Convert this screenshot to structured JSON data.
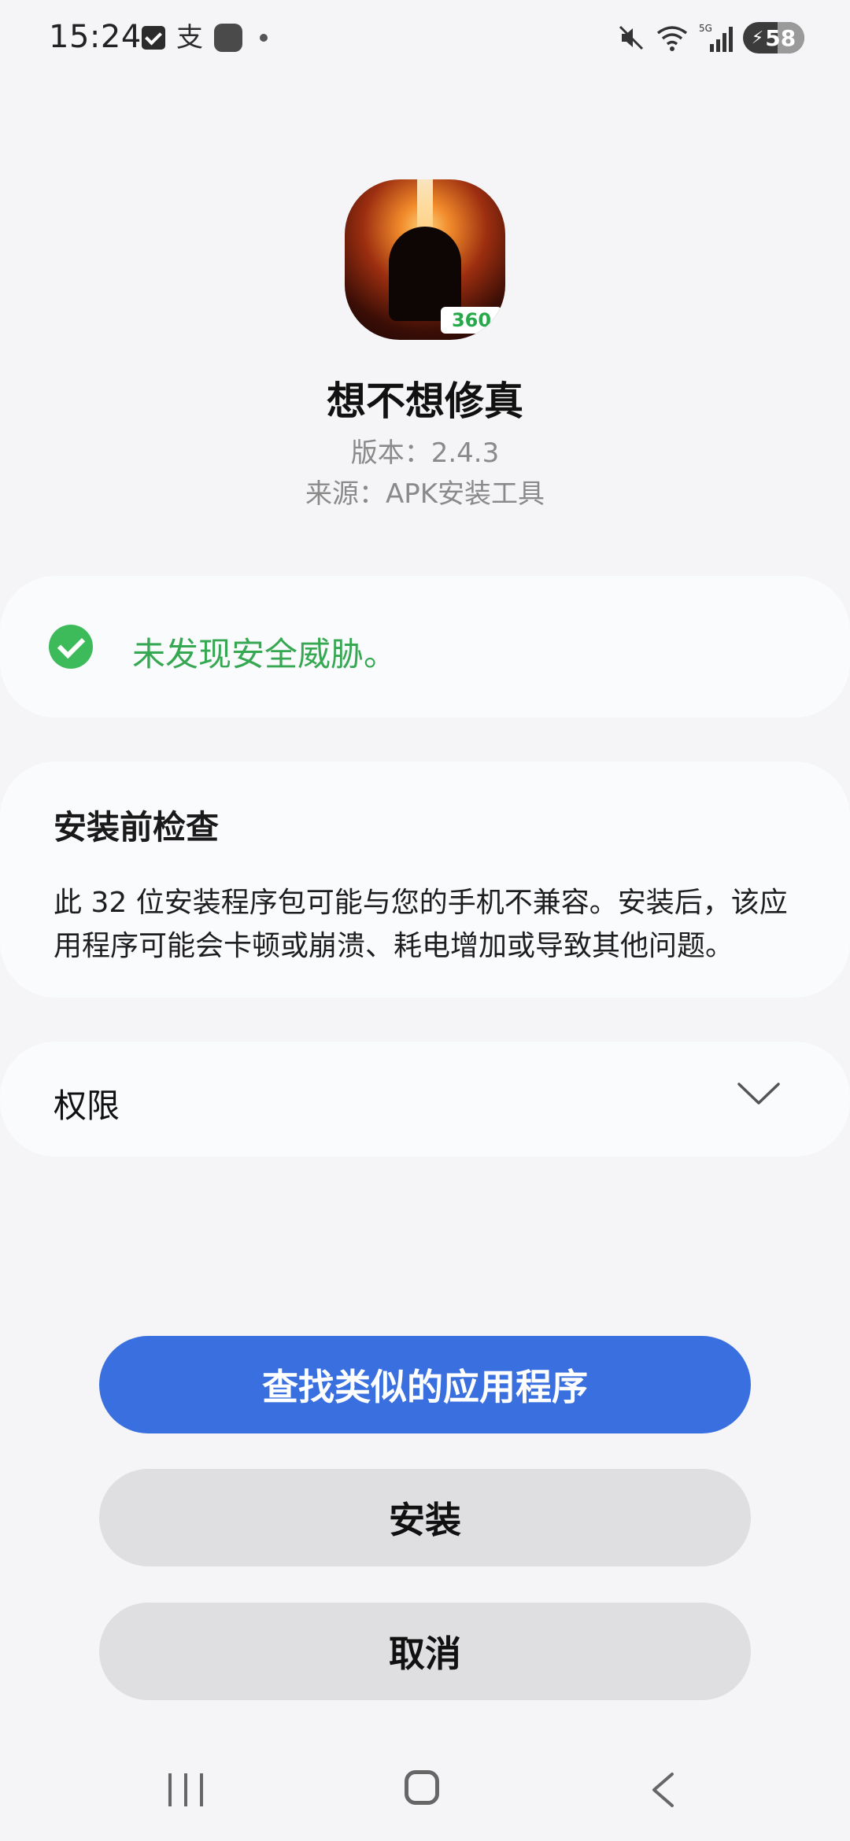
{
  "status_bar": {
    "time": "15:24",
    "left_icons": [
      "checkbox-icon",
      "alipay-icon",
      "app-notification-icon",
      "dot-icon"
    ],
    "right_icons": [
      "mute-icon",
      "wifi-icon",
      "signal-5g-icon"
    ],
    "network_label": "5G",
    "battery_level": "58",
    "charging": true
  },
  "app": {
    "name": "想不想修真",
    "version": "版本：2.4.3",
    "source": "来源：APK安装工具",
    "icon_badge": "360"
  },
  "security": {
    "message": "未发现安全威胁。",
    "color": "#36a852"
  },
  "precheck": {
    "title": "安装前检查",
    "body": "此 32 位安装程序包可能与您的手机不兼容。安装后，该应用程序可能会卡顿或崩溃、耗电增加或导致其他问题。"
  },
  "permissions": {
    "label": "权限"
  },
  "buttons": {
    "find_similar": "查找类似的应用程序",
    "install": "安装",
    "cancel": "取消"
  },
  "colors": {
    "primary": "#3a6fdf",
    "secondary_button": "#dfdfe2",
    "background": "#f5f5f8"
  },
  "nav": {
    "items": [
      "recent-apps-icon",
      "home-icon",
      "back-icon"
    ]
  }
}
